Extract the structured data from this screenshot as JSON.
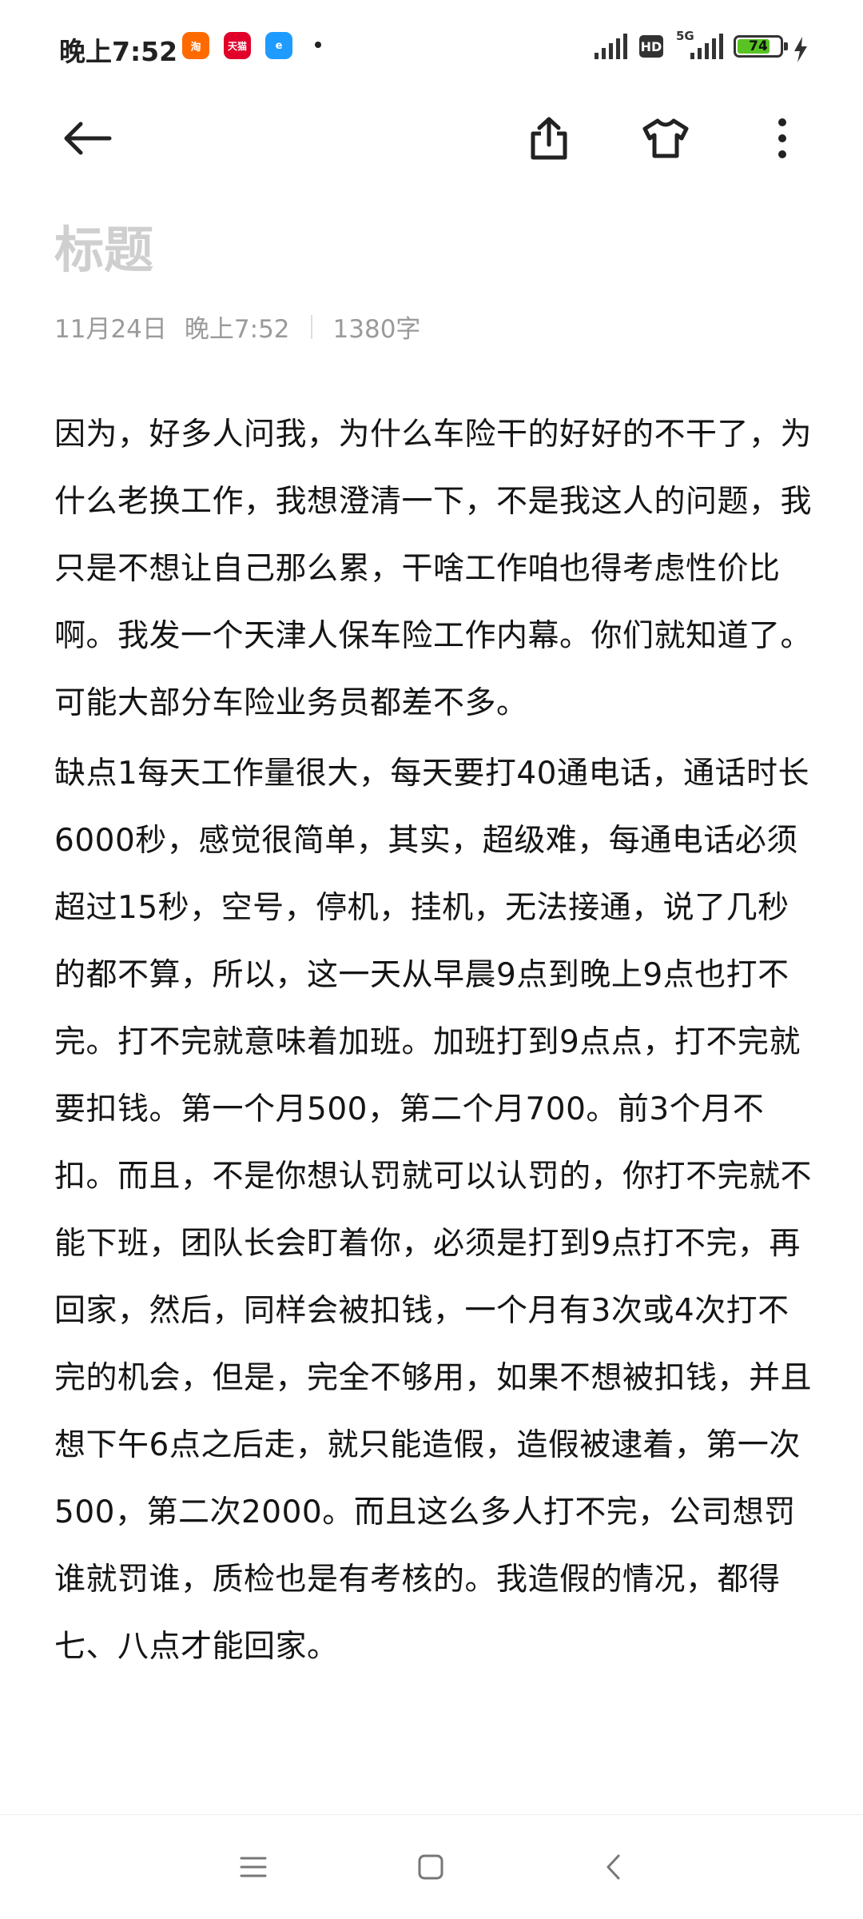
{
  "status_bar": {
    "time": "晚上7:52",
    "app_icons": [
      "taobao-icon",
      "tmall-icon",
      "eleme-icon"
    ],
    "tmall_label": "天猫",
    "hd_label": "HD",
    "network": "5G",
    "battery": "74"
  },
  "toolbar": {
    "back_icon": "back-arrow-icon",
    "share_icon": "share-icon",
    "theme_icon": "tshirt-icon",
    "more_icon": "more-vertical-icon"
  },
  "note": {
    "title_placeholder": "标题",
    "date": "11月24日",
    "time": "晚上7:52",
    "word_count": "1380字",
    "paragraphs": [
      "因为，好多人问我，为什么车险干的好好的不干了，为什么老换工作，我想澄清一下，不是我这人的问题，我只是不想让自己那么累，干啥工作咱也得考虑性价比啊。我发一个天津人保车险工作内幕。你们就知道了。可能大部分车险业务员都差不多。",
      "缺点1每天工作量很大，每天要打40通电话，通话时长6000秒，感觉很简单，其实，超级难，每通电话必须超过15秒，空号，停机，挂机，无法接通，说了几秒的都不算，所以，这一天从早晨9点到晚上9点也打不完。打不完就意味着加班。加班打到9点点，打不完就要扣钱。第一个月500，第二个月700。前3个月不扣。而且，不是你想认罚就可以认罚的，你打不完就不能下班，团队长会盯着你，必须是打到9点打不完，再回家，然后，同样会被扣钱，一个月有3次或4次打不完的机会，但是，完全不够用，如果不想被扣钱，并且想下午6点之后走，就只能造假，造假被逮着，第一次500，第二次2000。而且这么多人打不完，公司想罚谁就罚谁，质检也是有考核的。我造假的情况，都得七、八点才能回家。"
    ]
  },
  "navbar": {
    "menu_icon": "menu-icon",
    "home_icon": "home-square-icon",
    "back_icon": "nav-back-icon"
  }
}
